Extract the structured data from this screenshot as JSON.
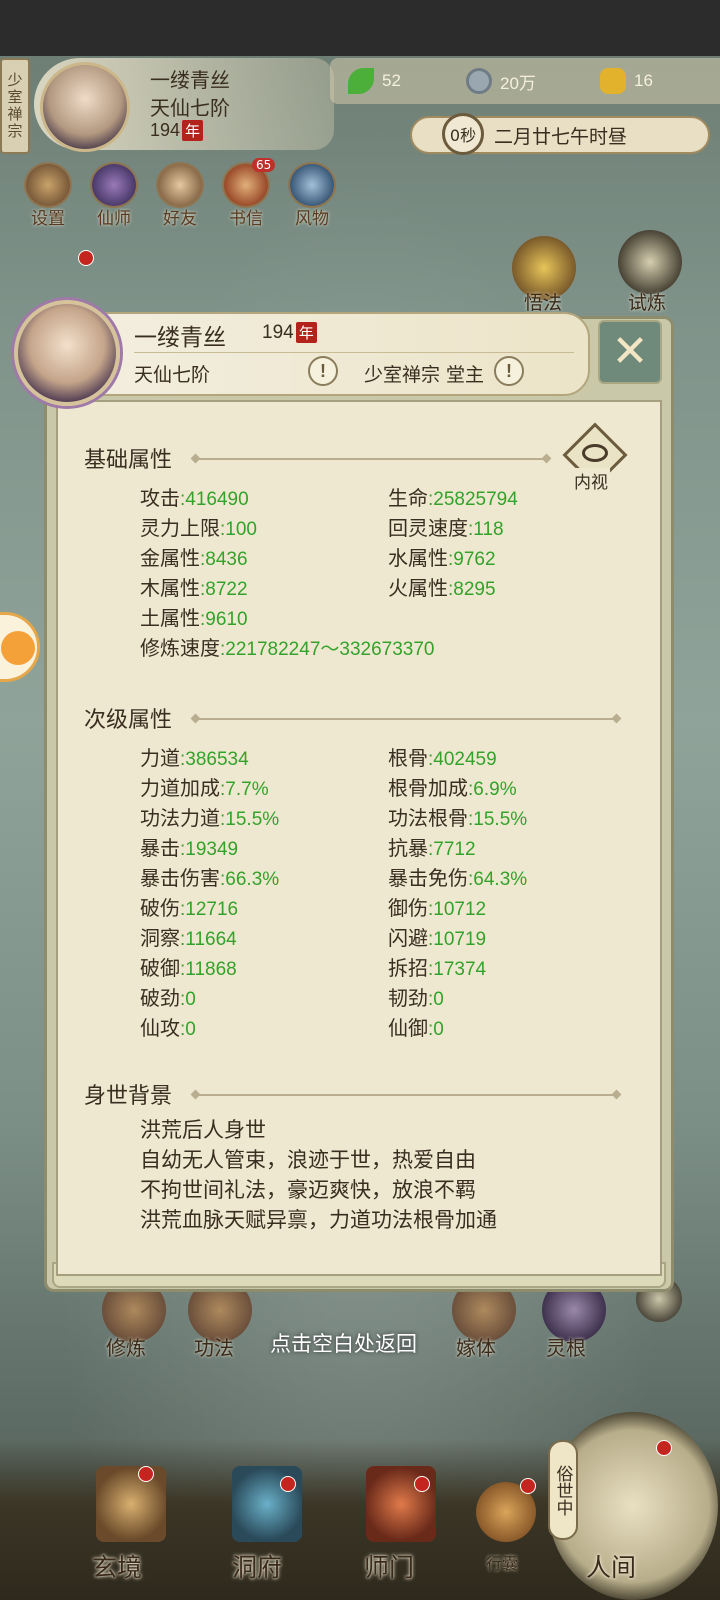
{
  "top_bar": {
    "sect_tag": "少室禅宗",
    "player_name": "一缕青丝",
    "realm": "天仙七阶",
    "age_value": "194",
    "age_unit": "年",
    "resources": [
      {
        "icon": "leaf-icon",
        "value": "52"
      },
      {
        "icon": "coin-icon",
        "value": "20万"
      },
      {
        "icon": "muscle-icon",
        "value": "16"
      }
    ],
    "timer": "0秒",
    "date_text": "二月廿七午时昼"
  },
  "quick_menu": [
    {
      "label": "设置",
      "icon": "settings-icon"
    },
    {
      "label": "仙师",
      "icon": "master-icon"
    },
    {
      "label": "好友",
      "icon": "friends-icon"
    },
    {
      "label": "书信",
      "icon": "letter-icon",
      "badge": "65"
    },
    {
      "label": "风物",
      "icon": "scenery-icon"
    }
  ],
  "side_buttons": [
    {
      "label": "悟法",
      "icon": "enlighten-icon"
    },
    {
      "label": "试炼",
      "icon": "trial-icon"
    }
  ],
  "panel": {
    "name": "一缕青丝",
    "age_value": "194",
    "age_unit": "年",
    "realm": "天仙七阶",
    "sect_title": "少室禅宗 堂主",
    "warn_glyph": "!",
    "close_glyph": "✕",
    "inner_view_label": "内视",
    "basic_title": "基础属性",
    "basic_stats": [
      {
        "label": "攻击",
        "value": "416490"
      },
      {
        "label": "生命",
        "value": "25825794"
      },
      {
        "label": "灵力上限",
        "value": "100"
      },
      {
        "label": "回灵速度",
        "value": "118"
      },
      {
        "label": "金属性",
        "value": "8436"
      },
      {
        "label": "水属性",
        "value": "9762"
      },
      {
        "label": "木属性",
        "value": "8722"
      },
      {
        "label": "火属性",
        "value": "8295"
      },
      {
        "label": "土属性",
        "value": "9610"
      }
    ],
    "cultivation_speed": {
      "label": "修炼速度",
      "value": "221782247～332673370"
    },
    "secondary_title": "次级属性",
    "secondary_stats": [
      {
        "label": "力道",
        "value": "386534"
      },
      {
        "label": "根骨",
        "value": "402459"
      },
      {
        "label": "力道加成",
        "value": "7.7%"
      },
      {
        "label": "根骨加成",
        "value": "6.9%"
      },
      {
        "label": "功法力道",
        "value": "15.5%"
      },
      {
        "label": "功法根骨",
        "value": "15.5%"
      },
      {
        "label": "暴击",
        "value": "19349"
      },
      {
        "label": "抗暴",
        "value": "7712"
      },
      {
        "label": "暴击伤害",
        "value": "66.3%"
      },
      {
        "label": "暴击免伤",
        "value": "64.3%"
      },
      {
        "label": "破伤",
        "value": "12716"
      },
      {
        "label": "御伤",
        "value": "10712"
      },
      {
        "label": "洞察",
        "value": "11664"
      },
      {
        "label": "闪避",
        "value": "10719"
      },
      {
        "label": "破御",
        "value": "11868"
      },
      {
        "label": "拆招",
        "value": "17374"
      },
      {
        "label": "破劲",
        "value": "0"
      },
      {
        "label": "韧劲",
        "value": "0"
      },
      {
        "label": "仙攻",
        "value": "0"
      },
      {
        "label": "仙御",
        "value": "0"
      }
    ],
    "background_title": "身世背景",
    "background_lines": [
      "洪荒后人身世",
      "自幼无人管束，浪迹于世，热爱自由",
      "不拘世间礼法，豪迈爽快，放浪不羁",
      "洪荒血脉天赋异禀，力道功法根骨加通"
    ]
  },
  "bottom_actions": [
    {
      "label": "修炼"
    },
    {
      "label": "功法"
    },
    {
      "label": "点击空白处返回"
    },
    {
      "label": "嫁体"
    },
    {
      "label": "灵根"
    }
  ],
  "nav": {
    "items": [
      {
        "label": "玄境"
      },
      {
        "label": "洞府"
      },
      {
        "label": "师门"
      }
    ],
    "bag_label": "行囊",
    "world_tag": "俗世中",
    "world_label": "人间"
  }
}
